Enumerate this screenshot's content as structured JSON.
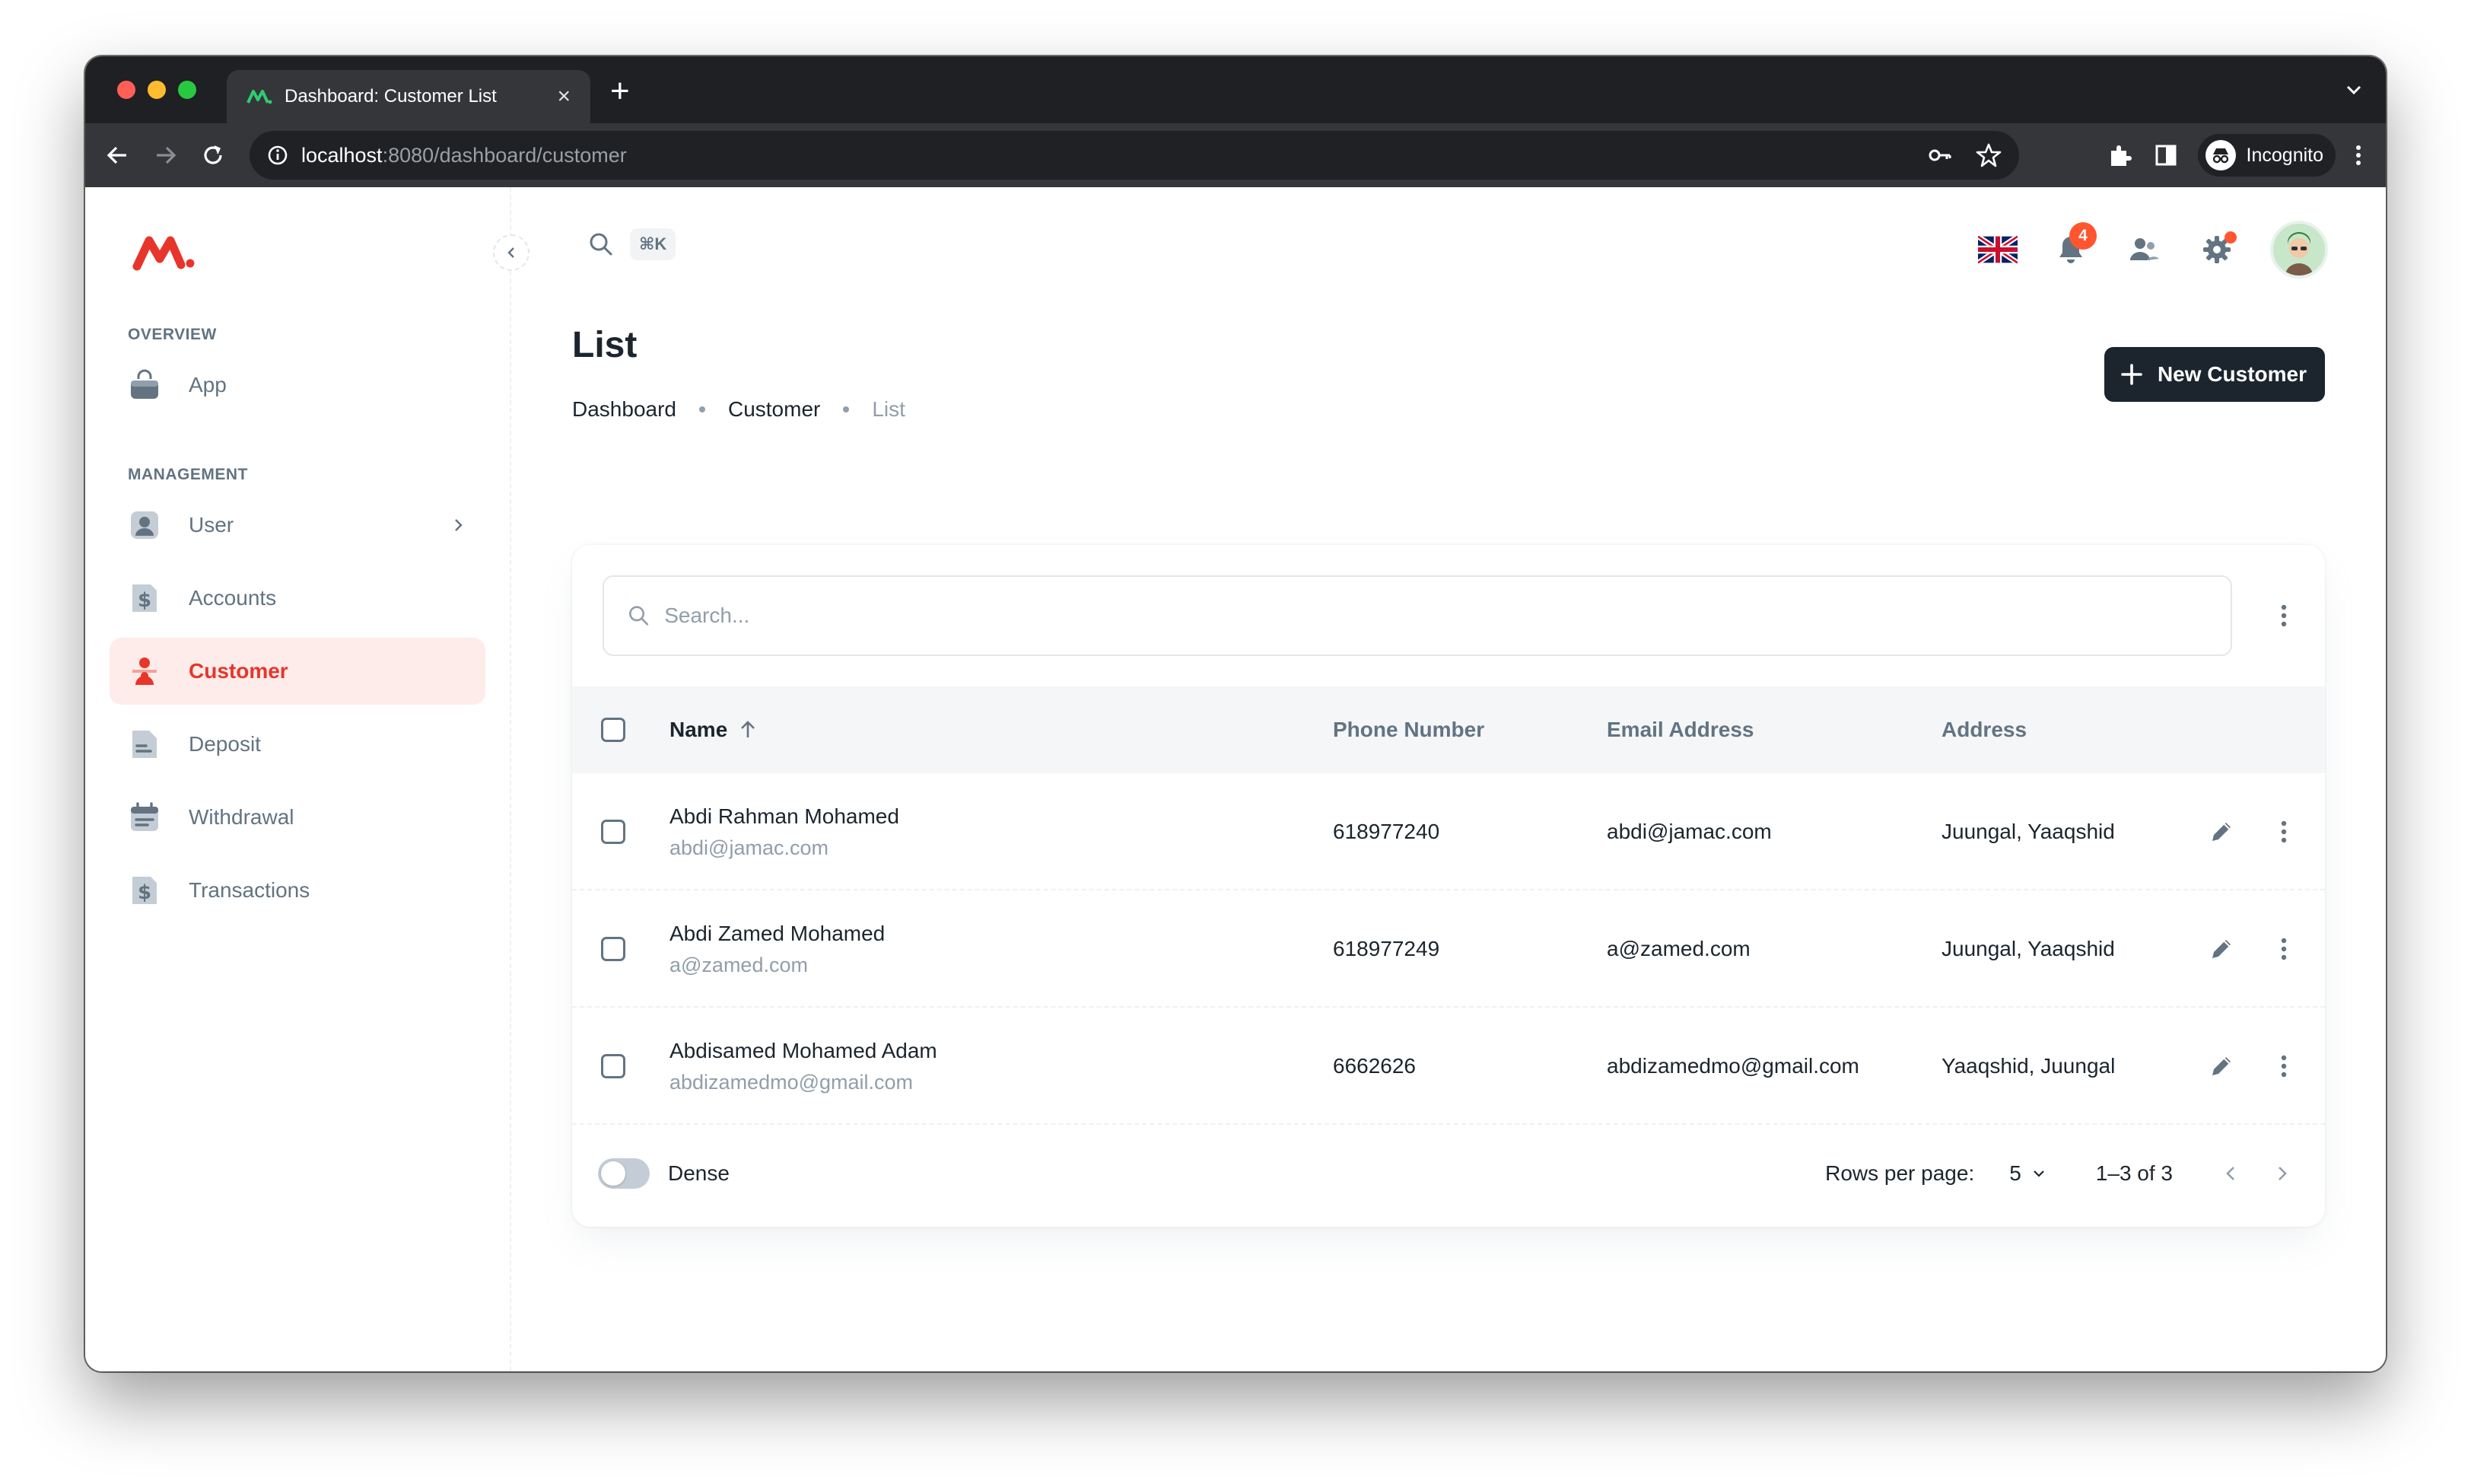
{
  "browser": {
    "tab_title": "Dashboard: Customer List",
    "url_host": "localhost",
    "url_path": ":8080/dashboard/customer",
    "profile_label": "Incognito"
  },
  "sidebar": {
    "overview_label": "OVERVIEW",
    "management_label": "MANAGEMENT",
    "items": [
      {
        "label": "App",
        "icon": "bag-icon"
      },
      {
        "label": "User",
        "icon": "user-icon"
      },
      {
        "label": "Accounts",
        "icon": "invoice-icon"
      },
      {
        "label": "Customer",
        "icon": "customer-icon",
        "active": true
      },
      {
        "label": "Deposit",
        "icon": "file-icon"
      },
      {
        "label": "Withdrawal",
        "icon": "calendar-icon"
      },
      {
        "label": "Transactions",
        "icon": "invoice-icon"
      }
    ]
  },
  "topbar": {
    "search_shortcut": "⌘K",
    "notification_count": "4"
  },
  "page": {
    "title": "List",
    "breadcrumb": [
      "Dashboard",
      "Customer",
      "List"
    ],
    "new_button": "New Customer"
  },
  "table": {
    "search_placeholder": "Search...",
    "headers": {
      "name": "Name",
      "phone": "Phone Number",
      "email": "Email Address",
      "address": "Address"
    },
    "rows": [
      {
        "name": "Abdi Rahman Mohamed",
        "name_email": "abdi@jamac.com",
        "phone": "618977240",
        "email": "abdi@jamac.com",
        "address": "Juungal, Yaaqshid"
      },
      {
        "name": "Abdi Zamed Mohamed",
        "name_email": "a@zamed.com",
        "phone": "618977249",
        "email": "a@zamed.com",
        "address": "Juungal, Yaaqshid"
      },
      {
        "name": "Abdisamed Mohamed Adam",
        "name_email": "abdizamedmo@gmail.com",
        "phone": "6662626",
        "email": "abdizamedmo@gmail.com",
        "address": "Yaaqshid, Juungal"
      }
    ],
    "footer": {
      "dense_label": "Dense",
      "rows_per_page_label": "Rows per page:",
      "rows_per_page": "5",
      "range": "1–3 of 3"
    }
  },
  "colors": {
    "accent": "#e8352b",
    "dark_button": "#1c252e",
    "badge": "#ff5630"
  }
}
